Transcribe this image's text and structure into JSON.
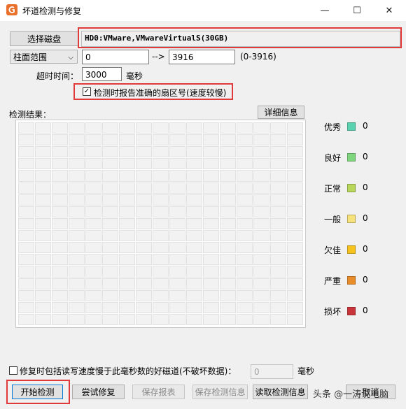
{
  "window": {
    "title": "坏道检测与修复",
    "minimize": "—",
    "maximize": "☐",
    "close": "✕"
  },
  "disk": {
    "select_button": "选择磁盘",
    "name": "HD0:VMware,VMwareVirtualS(30GB)"
  },
  "range": {
    "mode_label": "柱面范围",
    "start": "0",
    "arrow": "-->",
    "end": "3916",
    "hint": "(0-3916)"
  },
  "timeout": {
    "label": "超时时间：",
    "value": "3000",
    "unit": "毫秒"
  },
  "report_check": {
    "label": "检测时报告准确的扇区号(速度较慢)",
    "checked": true,
    "mark": "✓"
  },
  "results": {
    "label": "检测结果：",
    "details_button": "详细信息"
  },
  "legend": [
    {
      "label": "优秀",
      "color": "#5bd3b0",
      "count": "0"
    },
    {
      "label": "良好",
      "color": "#7fd67f",
      "count": "0"
    },
    {
      "label": "正常",
      "color": "#b7d65a",
      "count": "0"
    },
    {
      "label": "一般",
      "color": "#f6e27a",
      "count": "0"
    },
    {
      "label": "欠佳",
      "color": "#f6c21e",
      "count": "0"
    },
    {
      "label": "严重",
      "color": "#e88d2a",
      "count": "0"
    },
    {
      "label": "损坏",
      "color": "#c9343a",
      "count": "0"
    }
  ],
  "repair_option": {
    "label": "修复时包括读写速度慢于此毫秒数的好磁道(不破坏数据)：",
    "checked": false,
    "value": "0",
    "unit": "毫秒"
  },
  "buttons": {
    "start": "开始检测",
    "try_repair": "尝试修复",
    "save_report": "保存报表",
    "save_info": "保存检测信息",
    "read_info": "读取检测信息",
    "cancel": "取消"
  },
  "watermark": "头条 @一涛说电脑"
}
